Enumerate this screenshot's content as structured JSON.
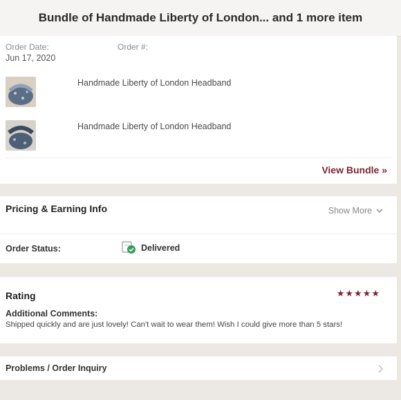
{
  "header": {
    "title": "Bundle of Handmade Liberty of London... and 1 more item"
  },
  "order": {
    "date_label": "Order Date:",
    "date_value": "Jun 17, 2020",
    "number_label": "Order #:"
  },
  "items": [
    {
      "name": "Handmade Liberty of London Headband"
    },
    {
      "name": "Handmade Liberty of London Headband"
    }
  ],
  "bundle": {
    "view_label": "View Bundle »"
  },
  "pricing": {
    "title": "Pricing & Earning Info",
    "show_more": "Show More"
  },
  "status": {
    "label": "Order Status:",
    "value": "Delivered"
  },
  "rating": {
    "title": "Rating",
    "stars": 5,
    "stars_text": "★★★★★",
    "comments_label": "Additional Comments:",
    "comment": "Shipped quickly and are just lovely! Can't wait to wear them! Wish I could give more than 5 stars!"
  },
  "problems": {
    "label": "Problems / Order Inquiry"
  },
  "colors": {
    "accent": "#7a2435",
    "delivered": "#2e9e53",
    "background": "#ece8e4"
  }
}
